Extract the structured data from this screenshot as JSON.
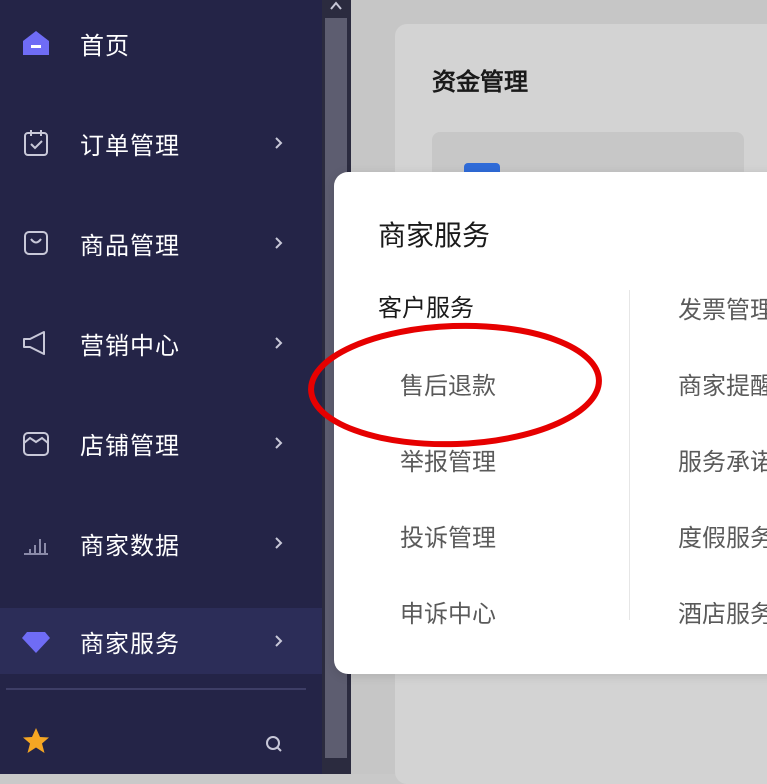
{
  "sidebar": {
    "items": [
      {
        "label": "首页",
        "icon": "home-icon"
      },
      {
        "label": "订单管理",
        "icon": "calendar-check-icon"
      },
      {
        "label": "商品管理",
        "icon": "bag-icon"
      },
      {
        "label": "营销中心",
        "icon": "megaphone-icon"
      },
      {
        "label": "店铺管理",
        "icon": "store-icon"
      },
      {
        "label": "商家数据",
        "icon": "bar-chart-icon"
      },
      {
        "label": "商家服务",
        "icon": "diamond-icon"
      }
    ],
    "bottom": {
      "star_icon": "star-icon",
      "search_icon": "search-icon"
    }
  },
  "main": {
    "card_title": "资金管理"
  },
  "popup": {
    "title": "商家服务",
    "left_section": "客户服务",
    "left_items": [
      "售后退款",
      "举报管理",
      "投诉管理",
      "申诉中心"
    ],
    "right_items": [
      "发票管理",
      "商家提醒",
      "服务承诺",
      "度假服务",
      "酒店服务"
    ]
  },
  "colors": {
    "sidebar_bg": "#242447",
    "sidebar_active_bg": "#2c2d58",
    "accent_purple": "#6f6cf5",
    "star_orange": "#f5a623",
    "annotation_red": "#e60000"
  }
}
